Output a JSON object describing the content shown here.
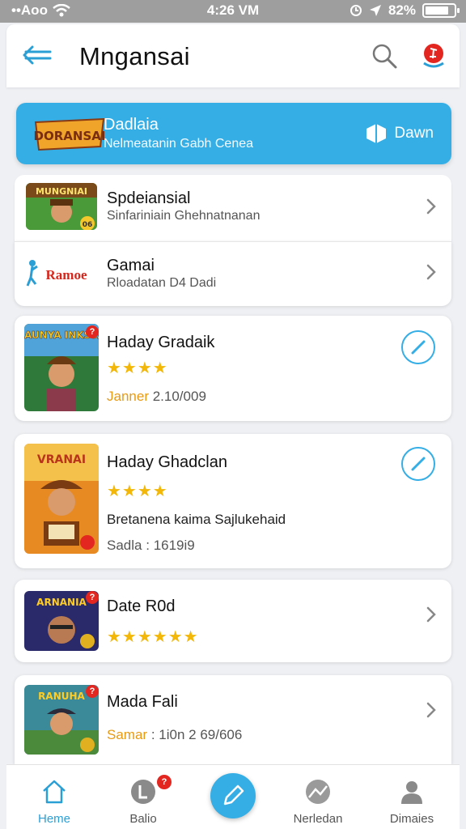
{
  "status_bar": {
    "carrier": "••Aoo",
    "time": "4:26 VM",
    "battery": "82%"
  },
  "app_bar": {
    "title": "Mngansai"
  },
  "banner": {
    "logo_text": "DORANSAI",
    "title": "Dadlaia",
    "subtitle": "Nelmeatanin Gabh Cenea",
    "action_label": "Dawn"
  },
  "items": [
    {
      "title": "Spdeiansial",
      "subtitle": "Sinfariniain Ghehnatnanan",
      "thumb_badge": "06",
      "thumb_label": "MUNGNIAI"
    },
    {
      "title": "Gamai",
      "subtitle": "Rloadatan D4 Dadi",
      "thumb_label": "Ramoe"
    }
  ],
  "games": [
    {
      "title": "Haday Gradaik",
      "stars": "★★★★",
      "meta_label": "Janner",
      "meta_value": "2.10/009",
      "thumb_label": "MAUNYA INKSSAI",
      "badge": "?"
    },
    {
      "title": "Haday Ghadclan",
      "stars": "★★★★",
      "description": "Bretanena kaima Sajlukehaid",
      "meta_label": "Sadla",
      "meta_value": "1619i9",
      "thumb_label": "VRANAI",
      "badge": "?"
    },
    {
      "title": "Date R0d",
      "stars": "★★★★★★",
      "thumb_label": "ARNANIA",
      "badge": "?"
    },
    {
      "title": "Mada Fali",
      "meta_label": "Samar",
      "meta_value": "1i0n 2 69/606",
      "thumb_label": "RANUHA",
      "badge": "?"
    }
  ],
  "bottom_nav": [
    {
      "label": "Heme",
      "icon": "home-icon"
    },
    {
      "label": "Balio",
      "icon": "clock-icon",
      "badge": "?"
    },
    {
      "label": "",
      "icon": "pencil-icon"
    },
    {
      "label": "Nerledan",
      "icon": "map-icon"
    },
    {
      "label": "Dimaies",
      "icon": "person-icon"
    }
  ],
  "colors": {
    "accent": "#35aee6",
    "star": "#f2b708",
    "badge": "#e3261f"
  }
}
